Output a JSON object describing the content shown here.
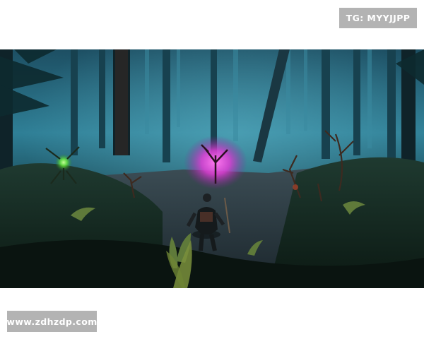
{
  "watermarks": {
    "top_right": "TG: MYYJJPP",
    "bottom_left": "www.zdhzdp.com"
  },
  "scene": {
    "colors": {
      "fog": "#2f7f96",
      "forest_dark": "#0c1f27",
      "portal_glow": "#e03cd6",
      "creature_eye": "#6cf03a",
      "ground": "#33414a"
    }
  }
}
